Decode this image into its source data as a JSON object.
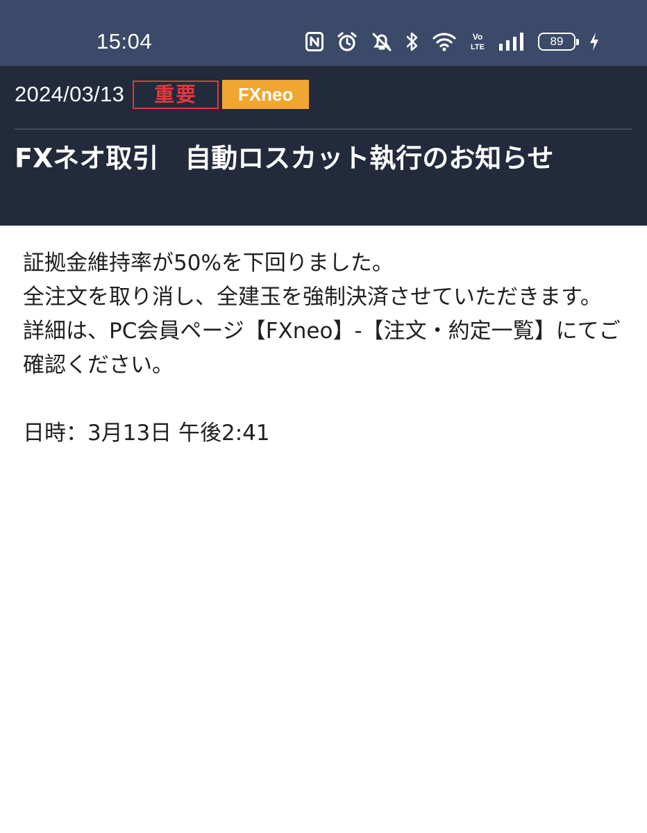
{
  "status_bar": {
    "time": "15:04",
    "icons": [
      "nfc-icon",
      "alarm-icon",
      "mute-icon",
      "bluetooth-icon",
      "wifi-icon",
      "volte-icon",
      "signal-icon",
      "battery-icon",
      "charging-icon"
    ],
    "volte_label_top": "Vo",
    "volte_label_bottom": "LTE",
    "battery_level": "89"
  },
  "header": {
    "date": "2024/03/13",
    "badge_important": "重要",
    "badge_category": "FXneo",
    "title": "FXネオ取引　自動ロスカット執行のお知らせ"
  },
  "body": {
    "paragraphs": [
      "証拠金維持率が50%を下回りました。",
      "全注文を取り消し、全建玉を強制決済させていただきます。",
      "詳細は、PC会員ページ【FXneo】-【注文・約定一覧】にてご確認ください。"
    ],
    "datetime": "日時：3月13日 午後2:41"
  },
  "colors": {
    "status_bar_bg": "#3b4a68",
    "header_bg": "#232a3b",
    "important_red": "#e0393e",
    "category_orange": "#f0a630"
  }
}
